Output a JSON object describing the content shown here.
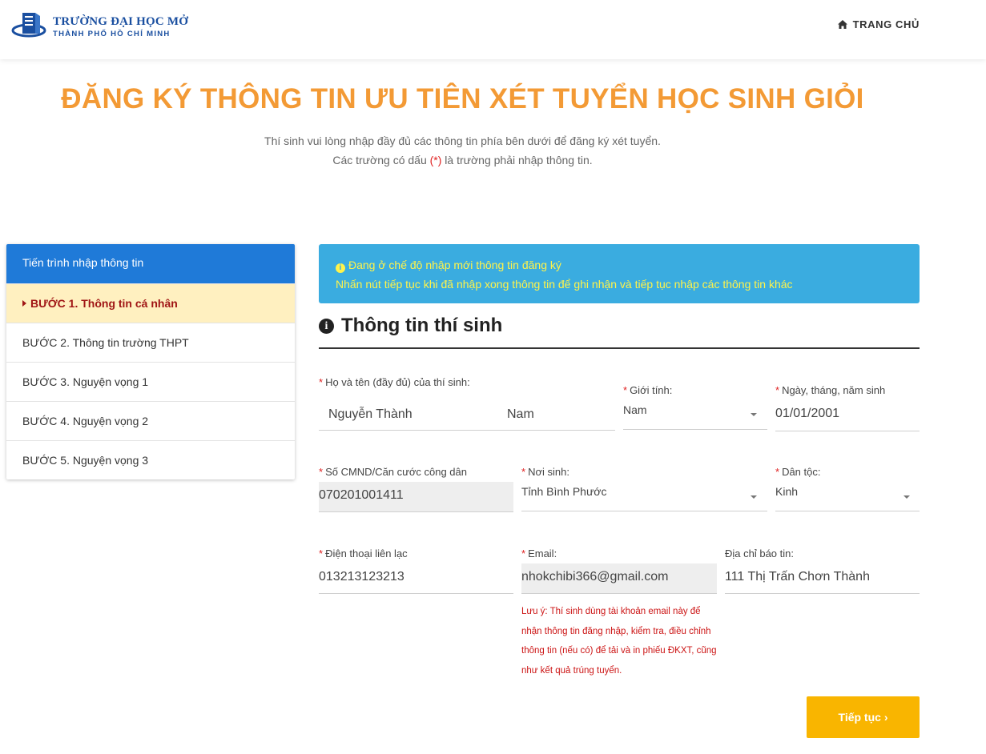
{
  "header": {
    "logo_line1": "TRƯỜNG ĐẠI HỌC MỞ",
    "logo_line2": "THÀNH PHỐ HỒ CHÍ MINH",
    "nav_home": "TRANG CHỦ",
    "brand_color": "#1a4fa0"
  },
  "page": {
    "title": "ĐĂNG KÝ THÔNG TIN ƯU TIÊN XÉT TUYỂN HỌC SINH GIỎI",
    "subtitle_line1": "Thí sinh vui lòng nhập đầy đủ các thông tin phía bên dưới để đăng ký xét tuyển.",
    "subtitle_line2_pre": "Các trường có dấu ",
    "subtitle_line2_mark": "(*)",
    "subtitle_line2_post": " là trường phải nhập thông tin.",
    "title_color": "#f39a35"
  },
  "sidebar": {
    "title": "Tiến trình nhập thông tin",
    "steps": [
      {
        "label": "BƯỚC 1. Thông tin cá nhân",
        "active": true
      },
      {
        "label": "BƯỚC 2. Thông tin trường THPT",
        "active": false
      },
      {
        "label": "BƯỚC 3. Nguyện vọng 1",
        "active": false
      },
      {
        "label": "BƯỚC 4. Nguyện vọng 2",
        "active": false
      },
      {
        "label": "BƯỚC 5. Nguyện vọng 3",
        "active": false
      }
    ]
  },
  "alert": {
    "line1": "Đang ở chế độ nhập mới thông tin đăng ký",
    "line2": "Nhấn nút tiếp tục khi đã nhập xong thông tin để ghi nhận và tiếp tục nhập các thông tin khác",
    "icon": "info-circle-icon"
  },
  "section": {
    "title": "Thông tin thí sinh"
  },
  "form": {
    "fullname": {
      "label": "Họ và tên (đầy đủ) của thí sinh:",
      "last_name": "Nguyễn Thành",
      "first_name": "Nam"
    },
    "gender": {
      "label": "Giới tính:",
      "value": "Nam"
    },
    "dob": {
      "label": "Ngày, tháng, năm sinh",
      "value": "01/01/2001"
    },
    "id_number": {
      "label": "Số CMND/Căn cước công dân",
      "value": "070201001411"
    },
    "birthplace": {
      "label": "Nơi sinh:",
      "value": "Tỉnh Bình Phước"
    },
    "ethnicity": {
      "label": "Dân tộc:",
      "value": "Kinh"
    },
    "phone": {
      "label": "Điện thoại liên lạc",
      "value": "013213123213"
    },
    "email": {
      "label": "Email:",
      "value": "nhokchibi366@gmail.com"
    },
    "address": {
      "label": "Địa chỉ báo tin:",
      "value": "111 Thị Trấn Chơn Thành"
    },
    "email_note": "Lưu ý: Thí sinh dùng tài khoản email này để nhận thông tin đăng nhập, kiểm tra, điều chỉnh thông tin (nếu có) để tải và in phiếu ĐKXT, cũng như kết quả trúng tuyển."
  },
  "buttons": {
    "next": "Tiếp tục ›"
  }
}
